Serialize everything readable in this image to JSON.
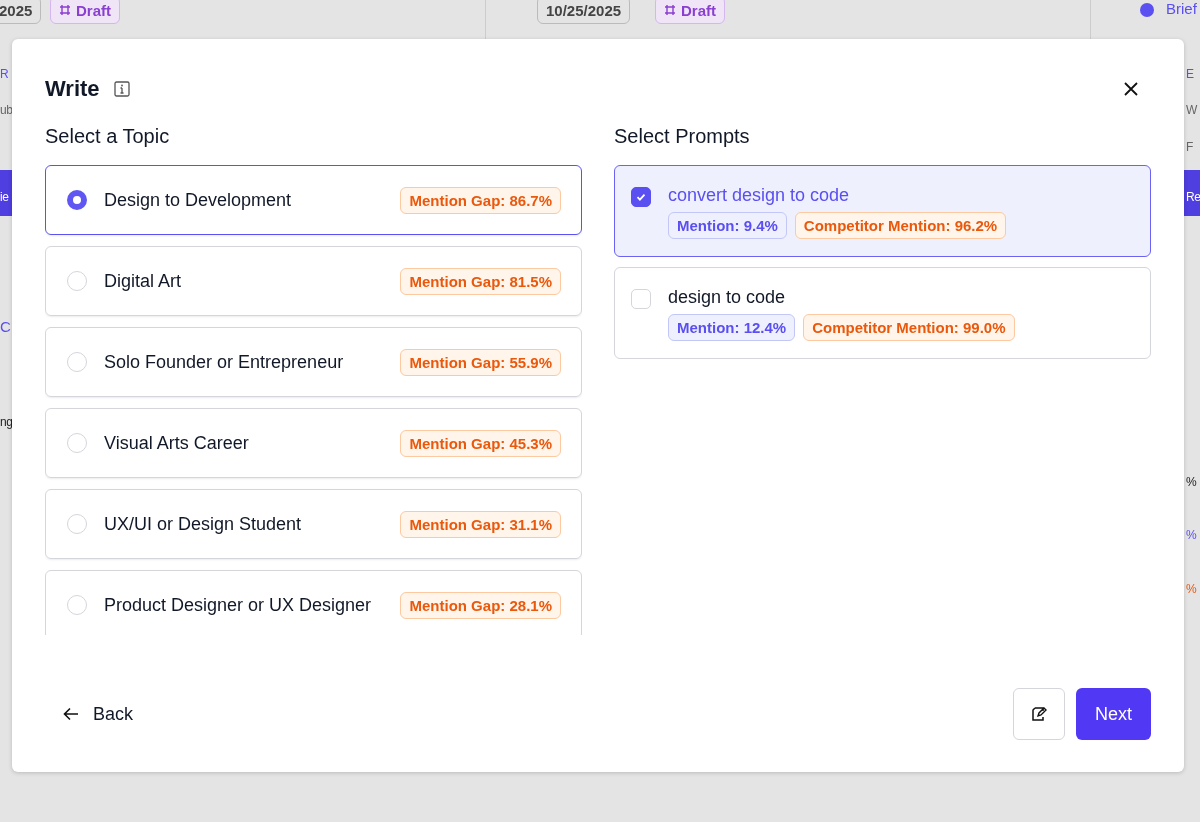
{
  "background": {
    "top_chips": [
      {
        "text": "2025",
        "kind": "date"
      },
      {
        "text": "Draft",
        "kind": "status"
      },
      {
        "text": "10/25/2025",
        "kind": "date"
      },
      {
        "text": "Draft",
        "kind": "status"
      }
    ],
    "right_top_link": "Brief",
    "left_fragments": [
      "R",
      "ub",
      "ie",
      "C",
      "ng"
    ],
    "right_fragments": [
      "E",
      "W",
      "F",
      "Re",
      "%",
      "%",
      "%"
    ]
  },
  "dialog": {
    "title": "Write",
    "topics_heading": "Select a Topic",
    "topics": [
      {
        "label": "Design to Development",
        "gap": "Mention Gap: 86.7%",
        "selected": true
      },
      {
        "label": "Digital Art",
        "gap": "Mention Gap: 81.5%",
        "selected": false
      },
      {
        "label": "Solo Founder or Entrepreneur",
        "gap": "Mention Gap: 55.9%",
        "selected": false
      },
      {
        "label": "Visual Arts Career",
        "gap": "Mention Gap: 45.3%",
        "selected": false
      },
      {
        "label": "UX/UI or Design Student",
        "gap": "Mention Gap: 31.1%",
        "selected": false
      },
      {
        "label": "Product Designer or UX Designer",
        "gap": "Mention Gap: 28.1%",
        "selected": false
      }
    ],
    "prompts_heading": "Select Prompts",
    "prompts": [
      {
        "label": "convert design to code",
        "mention": "Mention: 9.4%",
        "competitor": "Competitor Mention: 96.2%",
        "checked": true
      },
      {
        "label": "design to code",
        "mention": "Mention: 12.4%",
        "competitor": "Competitor Mention: 99.0%",
        "checked": false
      }
    ],
    "back": "Back",
    "next": "Next"
  }
}
